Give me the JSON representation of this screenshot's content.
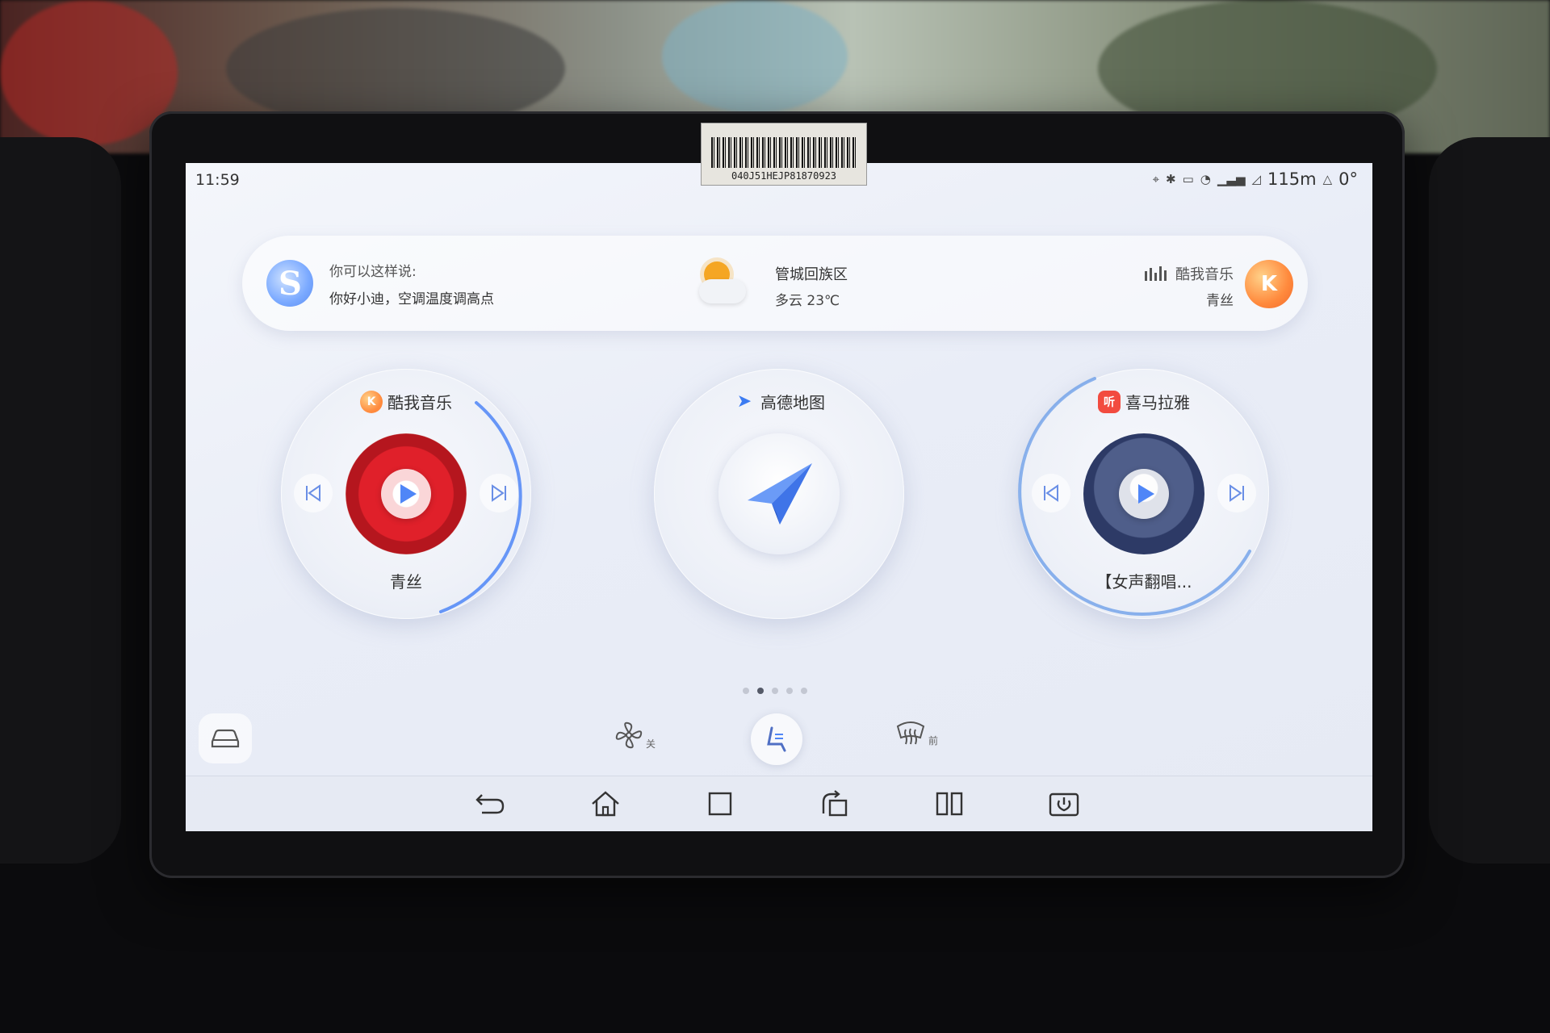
{
  "status": {
    "time": "11:59",
    "signal_text": "115m",
    "temp_text": "0°"
  },
  "sticker": {
    "code": "040J51HEJP81870923"
  },
  "voice_bar": {
    "hint_title": "你可以这样说:",
    "hint_text": "你好小迪，空调温度调高点",
    "weather_place": "管城回族区",
    "weather_info": "多云 23℃",
    "music_app": "酷我音乐",
    "music_song": "青丝"
  },
  "cards": {
    "music": {
      "app": "酷我音乐",
      "song": "青丝"
    },
    "nav": {
      "app": "高德地图"
    },
    "xima": {
      "app": "喜马拉雅",
      "song": "【女声翻唱..."
    }
  },
  "climate": {
    "fan_state": "关",
    "defrost_state": "前"
  },
  "pager": {
    "count": 5,
    "active": 1
  },
  "icons": {
    "voice_assistant": "voice-assistant-icon",
    "weather": "partly-cloudy-icon",
    "car": "car-icon",
    "fan": "fan-icon",
    "seat": "seat-ventilation-icon",
    "defrost": "front-defrost-icon",
    "back": "back-arrow-icon",
    "home": "home-icon",
    "recent": "square-icon",
    "screen_rotate": "rotate-screen-icon",
    "split": "split-screen-icon",
    "power": "power-icon"
  },
  "colors": {
    "accent": "#4f86f7",
    "kuwo": "#ff8a3d",
    "ximalaya": "#f24b3f"
  }
}
